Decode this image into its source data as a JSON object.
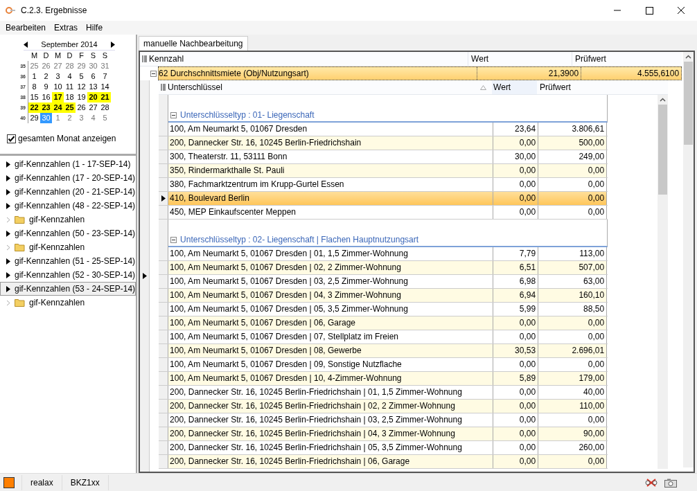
{
  "window": {
    "title": "C.2.3. Ergebnisse"
  },
  "menu": [
    "Bearbeiten",
    "Extras",
    "Hilfe"
  ],
  "calendar": {
    "month": "September 2014",
    "weekdays": [
      "M",
      "D",
      "M",
      "D",
      "F",
      "S",
      "S"
    ],
    "weeks": [
      {
        "number": "35",
        "days": [
          {
            "day": "25",
            "kind": "other",
            "marked": false,
            "selected": false
          },
          {
            "day": "26",
            "kind": "other",
            "marked": false,
            "selected": false
          },
          {
            "day": "27",
            "kind": "other",
            "marked": false,
            "selected": false
          },
          {
            "day": "28",
            "kind": "other",
            "marked": false,
            "selected": false
          },
          {
            "day": "29",
            "kind": "other",
            "marked": false,
            "selected": false
          },
          {
            "day": "30",
            "kind": "other",
            "marked": false,
            "selected": false
          },
          {
            "day": "31",
            "kind": "other",
            "marked": false,
            "selected": false
          }
        ]
      },
      {
        "number": "36",
        "days": [
          {
            "day": "1",
            "kind": "current",
            "marked": false,
            "selected": false
          },
          {
            "day": "2",
            "kind": "current",
            "marked": false,
            "selected": false
          },
          {
            "day": "3",
            "kind": "current",
            "marked": false,
            "selected": false
          },
          {
            "day": "4",
            "kind": "current",
            "marked": false,
            "selected": false
          },
          {
            "day": "5",
            "kind": "current",
            "marked": false,
            "selected": false
          },
          {
            "day": "6",
            "kind": "current",
            "marked": false,
            "selected": false
          },
          {
            "day": "7",
            "kind": "current",
            "marked": false,
            "selected": false
          }
        ]
      },
      {
        "number": "37",
        "days": [
          {
            "day": "8",
            "kind": "current",
            "marked": false,
            "selected": false
          },
          {
            "day": "9",
            "kind": "current",
            "marked": false,
            "selected": false
          },
          {
            "day": "10",
            "kind": "current",
            "marked": false,
            "selected": false
          },
          {
            "day": "11",
            "kind": "current",
            "marked": false,
            "selected": false
          },
          {
            "day": "12",
            "kind": "current",
            "marked": false,
            "selected": false
          },
          {
            "day": "13",
            "kind": "current",
            "marked": false,
            "selected": false
          },
          {
            "day": "14",
            "kind": "current",
            "marked": false,
            "selected": false
          }
        ]
      },
      {
        "number": "38",
        "days": [
          {
            "day": "15",
            "kind": "current",
            "marked": false,
            "selected": false
          },
          {
            "day": "16",
            "kind": "current",
            "marked": false,
            "selected": false
          },
          {
            "day": "17",
            "kind": "current",
            "marked": true,
            "selected": false
          },
          {
            "day": "18",
            "kind": "current",
            "marked": false,
            "selected": false
          },
          {
            "day": "19",
            "kind": "current",
            "marked": false,
            "selected": false
          },
          {
            "day": "20",
            "kind": "current",
            "marked": true,
            "selected": false
          },
          {
            "day": "21",
            "kind": "current",
            "marked": true,
            "selected": false
          }
        ]
      },
      {
        "number": "39",
        "days": [
          {
            "day": "22",
            "kind": "current",
            "marked": true,
            "selected": false
          },
          {
            "day": "23",
            "kind": "current",
            "marked": true,
            "selected": false
          },
          {
            "day": "24",
            "kind": "current",
            "marked": true,
            "selected": false
          },
          {
            "day": "25",
            "kind": "current",
            "marked": true,
            "selected": false
          },
          {
            "day": "26",
            "kind": "current",
            "marked": false,
            "selected": false
          },
          {
            "day": "27",
            "kind": "current",
            "marked": false,
            "selected": false
          },
          {
            "day": "28",
            "kind": "current",
            "marked": false,
            "selected": false
          }
        ]
      },
      {
        "number": "40",
        "days": [
          {
            "day": "29",
            "kind": "current",
            "marked": false,
            "selected": false
          },
          {
            "day": "30",
            "kind": "current",
            "marked": false,
            "selected": true
          },
          {
            "day": "1",
            "kind": "other",
            "marked": false,
            "selected": false
          },
          {
            "day": "2",
            "kind": "other",
            "marked": false,
            "selected": false
          },
          {
            "day": "3",
            "kind": "other",
            "marked": false,
            "selected": false
          },
          {
            "day": "4",
            "kind": "other",
            "marked": false,
            "selected": false
          },
          {
            "day": "5",
            "kind": "other",
            "marked": false,
            "selected": false
          }
        ]
      }
    ]
  },
  "month_checkbox": {
    "label": "gesamten Monat anzeigen",
    "checked": true
  },
  "tree": [
    {
      "label": "gif-Kennzahlen (1 - 17-SEP-14)",
      "kind": "node",
      "selected": false
    },
    {
      "label": "gif-Kennzahlen (17 - 20-SEP-14)",
      "kind": "node",
      "selected": false
    },
    {
      "label": "gif-Kennzahlen (20 - 21-SEP-14)",
      "kind": "node",
      "selected": false
    },
    {
      "label": "gif-Kennzahlen (48 - 22-SEP-14)",
      "kind": "node",
      "selected": false
    },
    {
      "label": "gif-Kennzahlen",
      "kind": "folder",
      "selected": false
    },
    {
      "label": "gif-Kennzahlen (50 - 23-SEP-14)",
      "kind": "node",
      "selected": false
    },
    {
      "label": "gif-Kennzahlen",
      "kind": "folder",
      "selected": false
    },
    {
      "label": "gif-Kennzahlen (51 - 25-SEP-14)",
      "kind": "node",
      "selected": false
    },
    {
      "label": "gif-Kennzahlen (52 - 30-SEP-14)",
      "kind": "node",
      "selected": false
    },
    {
      "label": "gif-Kennzahlen (53 - 24-SEP-14)",
      "kind": "node",
      "selected": true
    },
    {
      "label": "gif-Kennzahlen",
      "kind": "folder",
      "selected": false
    }
  ],
  "tabs": [
    {
      "label": "manuelle Nachbearbeitung",
      "selected": true
    }
  ],
  "grid": {
    "columns": [
      "Kennzahl",
      "Wert",
      "Prüfwert"
    ],
    "row": {
      "label": "62 Durchschnittsmiete (Obj/Nutzungsart)",
      "wert": "21,3900",
      "pruefwert": "4.555,6100",
      "expanded": true
    },
    "detail": {
      "columns": [
        "Unterschlüssel",
        "Wert",
        "Prüfwert"
      ],
      "groups": [
        {
          "title": "Unterschlüsseltyp : 01- Liegenschaft",
          "expanded": true,
          "rows": [
            {
              "key": "100, Am Neumarkt 5, 01067 Dresden",
              "wert": "23,64",
              "pruefwert": "3.806,61",
              "selected": false
            },
            {
              "key": "200, Dannecker Str. 16, 10245 Berlin-Friedrichshain",
              "wert": "0,00",
              "pruefwert": "500,00",
              "selected": false
            },
            {
              "key": "300, Theaterstr. 11, 53111 Bonn",
              "wert": "30,00",
              "pruefwert": "249,00",
              "selected": false
            },
            {
              "key": "350, Rindermarkthalle St. Pauli",
              "wert": "0,00",
              "pruefwert": "0,00",
              "selected": false
            },
            {
              "key": "380, Fachmarktzentrum im Krupp-Gurtel Essen",
              "wert": "0,00",
              "pruefwert": "0,00",
              "selected": false
            },
            {
              "key": "410, Boulevard Berlin",
              "wert": "0,00",
              "pruefwert": "0,00",
              "selected": true
            },
            {
              "key": "450, MEP Einkaufscenter Meppen",
              "wert": "0,00",
              "pruefwert": "0,00",
              "selected": false
            }
          ]
        },
        {
          "title": "Unterschlüsseltyp : 02- Liegenschaft | Flachen Hauptnutzungsart",
          "expanded": true,
          "rows": [
            {
              "key": "100, Am Neumarkt 5, 01067 Dresden | 01, 1,5 Zimmer-Wohnung",
              "wert": "7,79",
              "pruefwert": "113,00",
              "selected": false
            },
            {
              "key": "100, Am Neumarkt 5, 01067 Dresden | 02, 2 Zimmer-Wohnung",
              "wert": "6,51",
              "pruefwert": "507,00",
              "selected": false
            },
            {
              "key": "100, Am Neumarkt 5, 01067 Dresden | 03, 2,5 Zimmer-Wohnung",
              "wert": "6,98",
              "pruefwert": "63,00",
              "selected": false
            },
            {
              "key": "100, Am Neumarkt 5, 01067 Dresden | 04, 3 Zimmer-Wohnung",
              "wert": "6,94",
              "pruefwert": "160,10",
              "selected": false
            },
            {
              "key": "100, Am Neumarkt 5, 01067 Dresden | 05, 3,5 Zimmer-Wohnung",
              "wert": "5,99",
              "pruefwert": "88,50",
              "selected": false
            },
            {
              "key": "100, Am Neumarkt 5, 01067 Dresden | 06, Garage",
              "wert": "0,00",
              "pruefwert": "0,00",
              "selected": false
            },
            {
              "key": "100, Am Neumarkt 5, 01067 Dresden | 07, Stellplatz im Freien",
              "wert": "0,00",
              "pruefwert": "0,00",
              "selected": false
            },
            {
              "key": "100, Am Neumarkt 5, 01067 Dresden | 08, Gewerbe",
              "wert": "30,53",
              "pruefwert": "2.696,01",
              "selected": false
            },
            {
              "key": "100, Am Neumarkt 5, 01067 Dresden | 09, Sonstige Nutzflache",
              "wert": "0,00",
              "pruefwert": "0,00",
              "selected": false
            },
            {
              "key": "100, Am Neumarkt 5, 01067 Dresden | 10, 4-Zimmer-Wohnung",
              "wert": "5,89",
              "pruefwert": "179,00",
              "selected": false
            },
            {
              "key": "200, Dannecker Str. 16, 10245 Berlin-Friedrichshain | 01, 1,5 Zimmer-Wohnung",
              "wert": "0,00",
              "pruefwert": "40,00",
              "selected": false
            },
            {
              "key": "200, Dannecker Str. 16, 10245 Berlin-Friedrichshain | 02, 2 Zimmer-Wohnung",
              "wert": "0,00",
              "pruefwert": "110,00",
              "selected": false
            },
            {
              "key": "200, Dannecker Str. 16, 10245 Berlin-Friedrichshain | 03, 2,5 Zimmer-Wohnung",
              "wert": "0,00",
              "pruefwert": "0,00",
              "selected": false
            },
            {
              "key": "200, Dannecker Str. 16, 10245 Berlin-Friedrichshain | 04, 3 Zimmer-Wohnung",
              "wert": "0,00",
              "pruefwert": "90,00",
              "selected": false
            },
            {
              "key": "200, Dannecker Str. 16, 10245 Berlin-Friedrichshain | 05, 3,5 Zimmer-Wohnung",
              "wert": "0,00",
              "pruefwert": "260,00",
              "selected": false
            },
            {
              "key": "200, Dannecker Str. 16, 10245 Berlin-Friedrichshain | 06, Garage",
              "wert": "0,00",
              "pruefwert": "0,00",
              "selected": false
            }
          ]
        }
      ]
    }
  },
  "status_bar": [
    "realax",
    "BKZ1xx"
  ]
}
